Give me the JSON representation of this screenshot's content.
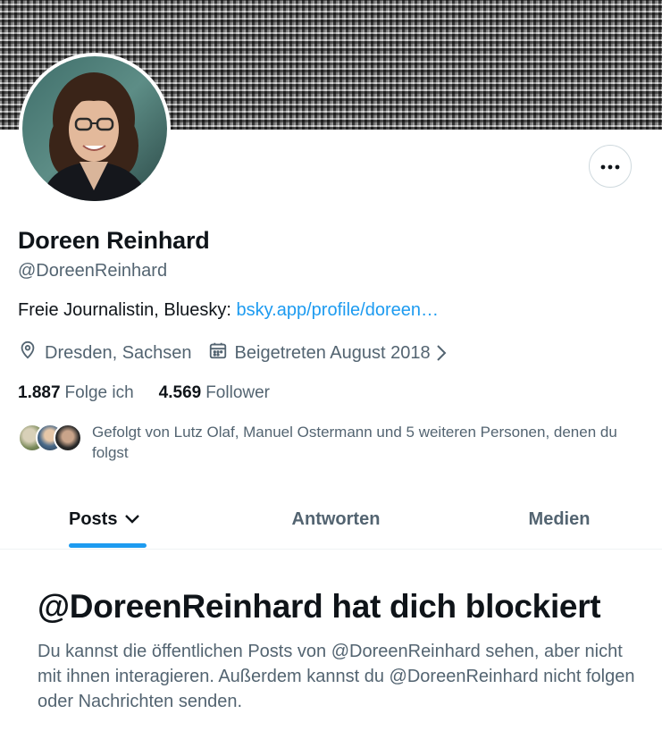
{
  "profile": {
    "display_name": "Doreen Reinhard",
    "handle": "@DoreenReinhard",
    "bio_text": "Freie Journalistin, Bluesky: ",
    "bio_link": "bsky.app/profile/doreen…",
    "location": "Dresden, Sachsen",
    "joined": "Beigetreten August 2018"
  },
  "stats": {
    "following_count": "1.887",
    "following_label": "Folge ich",
    "followers_count": "4.569",
    "followers_label": "Follower"
  },
  "followed_by": {
    "text": "Gefolgt von Lutz Olaf, Manuel Ostermann und 5 weiteren Personen, denen du folgst"
  },
  "tabs": [
    {
      "label": "Posts",
      "active": true
    },
    {
      "label": "Antworten",
      "active": false
    },
    {
      "label": "Medien",
      "active": false
    }
  ],
  "blocked": {
    "title": "@DoreenReinhard hat dich blockiert",
    "body": "Du kannst die öffentlichen Posts von @DoreenReinhard sehen, aber nicht mit ihnen interagieren. Außerdem kannst du @DoreenReinhard nicht folgen oder Nachrichten senden."
  },
  "icons": {
    "more": "more-horizontal-icon",
    "location": "location-pin-icon",
    "calendar": "calendar-icon",
    "tab_dropdown": "chevron-down-icon",
    "joined_chevron": "chevron-right-icon"
  },
  "colors": {
    "accent": "#1d9bf0",
    "text_primary": "#0f1419",
    "text_secondary": "#536471",
    "border": "#cfd9de"
  }
}
